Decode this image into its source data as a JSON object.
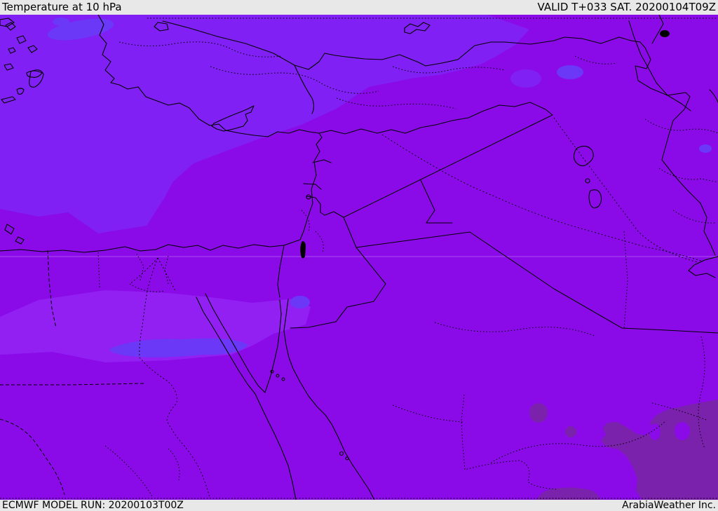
{
  "header": {
    "title": "Temperature at 10 hPa",
    "valid": "VALID T+033 SAT. 20200104T09Z"
  },
  "footer": {
    "model_run": "ECMWF MODEL RUN: 20200103T00Z",
    "brand": "ArabiaWeather Inc."
  },
  "map": {
    "type": "weather-temperature-shading-map",
    "region": "Middle East / Eastern Mediterranean",
    "palette": {
      "base": "#8a0be8",
      "band_light": "#8020f4",
      "band_light2": "#9320f2",
      "blob_lighter": "#6b38f7",
      "band_dark": "#7b22ac",
      "bar_bg": "#e8e8e8",
      "text": "#000000",
      "coastline": "#000000"
    }
  }
}
